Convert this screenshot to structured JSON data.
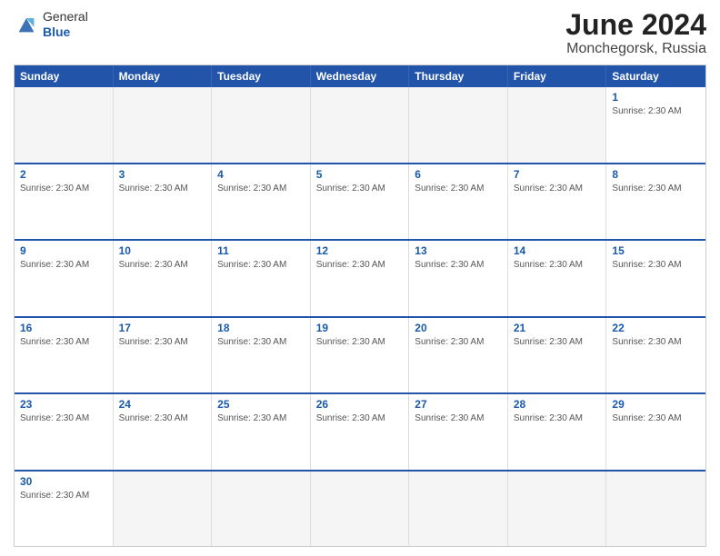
{
  "header": {
    "logo_general": "General",
    "logo_blue": "Blue",
    "month_year": "June 2024",
    "location": "Monchegorsk, Russia"
  },
  "weekdays": [
    "Sunday",
    "Monday",
    "Tuesday",
    "Wednesday",
    "Thursday",
    "Friday",
    "Saturday"
  ],
  "sunrise_text": "Sunrise: 2:30 AM",
  "rows": [
    [
      {
        "day": "",
        "info": "",
        "empty": true
      },
      {
        "day": "",
        "info": "",
        "empty": true
      },
      {
        "day": "",
        "info": "",
        "empty": true
      },
      {
        "day": "",
        "info": "",
        "empty": true
      },
      {
        "day": "",
        "info": "",
        "empty": true
      },
      {
        "day": "",
        "info": "",
        "empty": true
      },
      {
        "day": "1",
        "info": "Sunrise: 2:30 AM",
        "empty": false
      }
    ],
    [
      {
        "day": "2",
        "info": "Sunrise: 2:30 AM",
        "empty": false
      },
      {
        "day": "3",
        "info": "Sunrise: 2:30 AM",
        "empty": false
      },
      {
        "day": "4",
        "info": "Sunrise: 2:30 AM",
        "empty": false
      },
      {
        "day": "5",
        "info": "Sunrise: 2:30 AM",
        "empty": false
      },
      {
        "day": "6",
        "info": "Sunrise: 2:30 AM",
        "empty": false
      },
      {
        "day": "7",
        "info": "Sunrise: 2:30 AM",
        "empty": false
      },
      {
        "day": "8",
        "info": "Sunrise: 2:30 AM",
        "empty": false
      }
    ],
    [
      {
        "day": "9",
        "info": "Sunrise: 2:30 AM",
        "empty": false
      },
      {
        "day": "10",
        "info": "Sunrise: 2:30 AM",
        "empty": false
      },
      {
        "day": "11",
        "info": "Sunrise: 2:30 AM",
        "empty": false
      },
      {
        "day": "12",
        "info": "Sunrise: 2:30 AM",
        "empty": false
      },
      {
        "day": "13",
        "info": "Sunrise: 2:30 AM",
        "empty": false
      },
      {
        "day": "14",
        "info": "Sunrise: 2:30 AM",
        "empty": false
      },
      {
        "day": "15",
        "info": "Sunrise: 2:30 AM",
        "empty": false
      }
    ],
    [
      {
        "day": "16",
        "info": "Sunrise: 2:30 AM",
        "empty": false
      },
      {
        "day": "17",
        "info": "Sunrise: 2:30 AM",
        "empty": false
      },
      {
        "day": "18",
        "info": "Sunrise: 2:30 AM",
        "empty": false
      },
      {
        "day": "19",
        "info": "Sunrise: 2:30 AM",
        "empty": false
      },
      {
        "day": "20",
        "info": "Sunrise: 2:30 AM",
        "empty": false
      },
      {
        "day": "21",
        "info": "Sunrise: 2:30 AM",
        "empty": false
      },
      {
        "day": "22",
        "info": "Sunrise: 2:30 AM",
        "empty": false
      }
    ],
    [
      {
        "day": "23",
        "info": "Sunrise: 2:30 AM",
        "empty": false
      },
      {
        "day": "24",
        "info": "Sunrise: 2:30 AM",
        "empty": false
      },
      {
        "day": "25",
        "info": "Sunrise: 2:30 AM",
        "empty": false
      },
      {
        "day": "26",
        "info": "Sunrise: 2:30 AM",
        "empty": false
      },
      {
        "day": "27",
        "info": "Sunrise: 2:30 AM",
        "empty": false
      },
      {
        "day": "28",
        "info": "Sunrise: 2:30 AM",
        "empty": false
      },
      {
        "day": "29",
        "info": "Sunrise: 2:30 AM",
        "empty": false
      }
    ],
    [
      {
        "day": "30",
        "info": "Sunrise: 2:30 AM",
        "empty": false
      },
      {
        "day": "",
        "info": "",
        "empty": true
      },
      {
        "day": "",
        "info": "",
        "empty": true
      },
      {
        "day": "",
        "info": "",
        "empty": true
      },
      {
        "day": "",
        "info": "",
        "empty": true
      },
      {
        "day": "",
        "info": "",
        "empty": true
      },
      {
        "day": "",
        "info": "",
        "empty": true
      }
    ]
  ]
}
